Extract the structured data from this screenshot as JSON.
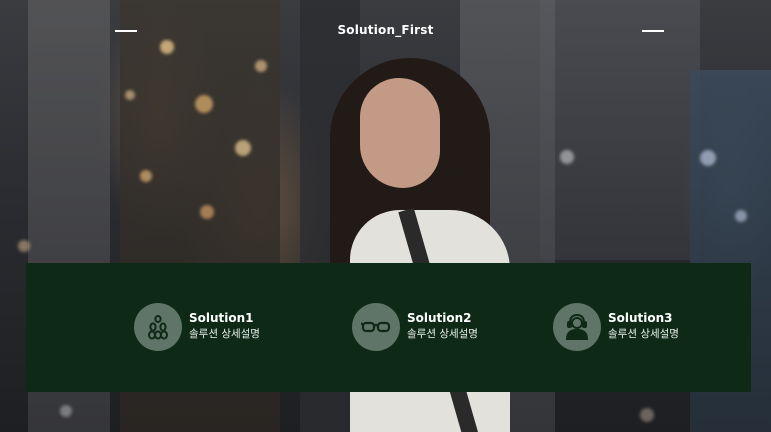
{
  "header": {
    "title": "Solution_First",
    "menu_icons": [
      "menu-line-left",
      "menu-line-right"
    ]
  },
  "solutions": [
    {
      "icon": "bowling-pins-icon",
      "title": "Solution1",
      "description": "솔루션 상세설명"
    },
    {
      "icon": "glasses-icon",
      "title": "Solution2",
      "description": "솔루션 상세설명"
    },
    {
      "icon": "user-headset-icon",
      "title": "Solution3",
      "description": "솔루션 상세설명"
    }
  ],
  "colors": {
    "panel": "#0e2a17",
    "icon_circle": "#5f7567",
    "text": "#ffffff"
  }
}
